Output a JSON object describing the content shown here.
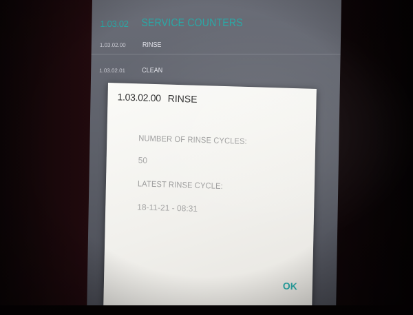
{
  "menu": {
    "header": {
      "code": "1.03.02",
      "title": "SERVICE COUNTERS"
    },
    "items": [
      {
        "code": "1.03.02.00",
        "label": "RINSE"
      },
      {
        "code": "1.03.02.01",
        "label": "CLEAN"
      }
    ]
  },
  "dialog": {
    "code": "1.03.02.00",
    "title": "RINSE",
    "fields": [
      {
        "label": "NUMBER OF RINSE CYCLES:",
        "value": "50"
      },
      {
        "label": "LATEST RINSE CYCLE:",
        "value": "18-11-21 - 08:31"
      }
    ],
    "ok_label": "OK"
  },
  "colors": {
    "accent": "#2aa8a6",
    "screen_bg": "#5d6069",
    "dialog_bg": "#f4f3ef"
  }
}
